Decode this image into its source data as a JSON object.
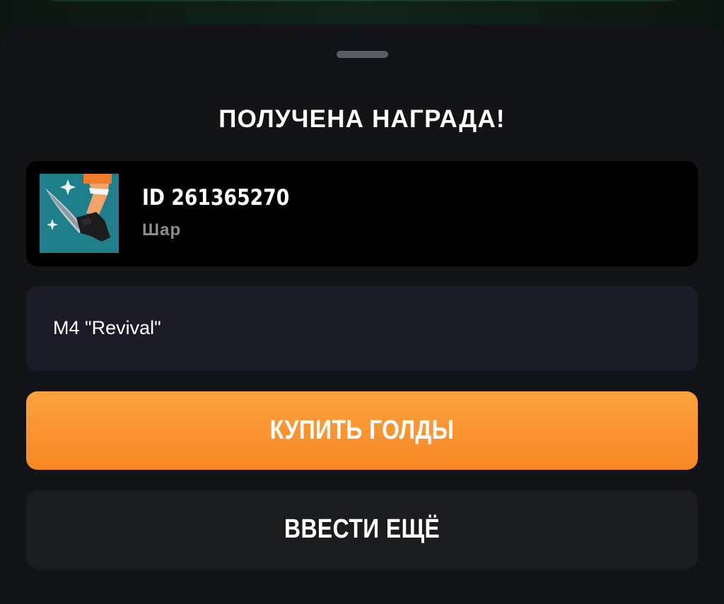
{
  "dialog": {
    "title": "ПОЛУЧЕНА НАГРАДА!"
  },
  "player": {
    "id_text": "ID 261365270",
    "name": "Шар",
    "game_icon": "knife-strike-game-icon"
  },
  "item": {
    "name": "M4 \"Revival\""
  },
  "actions": {
    "buy_label": "КУПИТЬ ГОЛДЫ",
    "more_label": "ВВЕСТИ ЕЩЁ"
  },
  "colors": {
    "accent": "#f7901f",
    "background": "#131418",
    "card": "#000000",
    "field": "#1b1c27"
  }
}
